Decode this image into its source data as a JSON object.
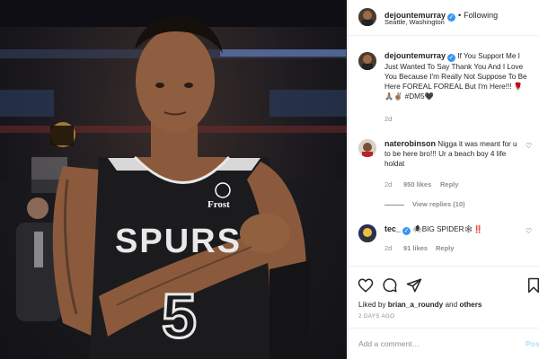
{
  "post": {
    "username": "dejountemurray",
    "follow_status": "Following",
    "location": "Seattle, Washington",
    "caption": "If You Support Me I Just Wanted To Say Thank You And I Love You Because I'm Really Not Suppose To Be Here FOREAL FOREAL But I'm Here!!! 🌹🙏🏽✌🏽 #DM5🖤",
    "caption_time": "2d",
    "likes_prefix": "Liked by",
    "liked_by_user": "brian_a_roundy",
    "likes_and": "and",
    "likes_others": "others",
    "posted_ago": "2 DAYS AGO",
    "add_comment_placeholder": "Add a comment…",
    "post_button": "Post"
  },
  "comments": [
    {
      "username": "naterobinson",
      "text": "Nigga it was meant for u to be here bro!!! Ur a beach boy 4 life holdat",
      "time": "2d",
      "likes": "950 likes",
      "reply": "Reply",
      "view_replies": "View replies (10)"
    },
    {
      "username": "tec_",
      "text": "🕷BIG SPIDER🕸‼️",
      "time": "2d",
      "likes": "91 likes",
      "reply": "Reply"
    }
  ],
  "photo": {
    "jersey_team": "SPURS",
    "jersey_number": "5",
    "sponsor": "Frost"
  },
  "icons": {
    "like": "heart-icon",
    "comment": "comment-icon",
    "share": "share-icon",
    "save": "bookmark-icon"
  },
  "colors": {
    "verified": "#3897f0",
    "post_button": "#b2dffc",
    "muted_text": "#8e8e8e"
  }
}
